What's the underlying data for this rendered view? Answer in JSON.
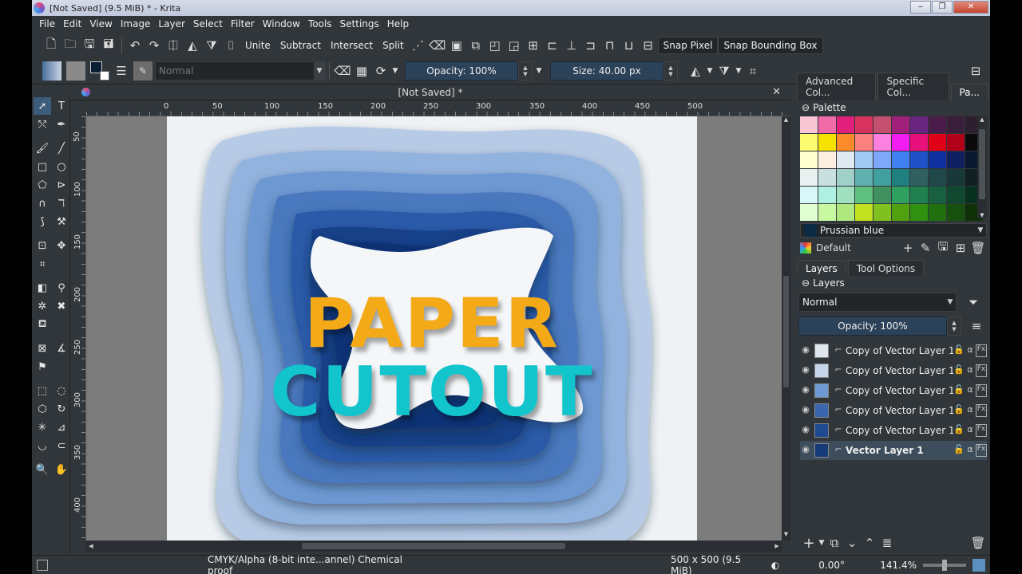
{
  "window": {
    "title": "[Not Saved]  (9.5 MiB)  * - Krita",
    "minimize": "‒",
    "restore": "❐",
    "close": "✕"
  },
  "menu": [
    "File",
    "Edit",
    "View",
    "Image",
    "Layer",
    "Select",
    "Filter",
    "Window",
    "Tools",
    "Settings",
    "Help"
  ],
  "toolbar": {
    "unite": "Unite",
    "subtract": "Subtract",
    "intersect": "Intersect",
    "split": "Split",
    "snap_pixel": "Snap Pixel",
    "snap_bbox": "Snap Bounding Box",
    "blend_mode": "Normal",
    "opacity": "Opacity: 100%",
    "size": "Size: 40.00 px"
  },
  "document": {
    "tab_title": "[Not Saved]   *",
    "ruler_h": [
      "0",
      "50",
      "100",
      "150",
      "200",
      "250",
      "300",
      "350",
      "400",
      "450",
      "500"
    ],
    "ruler_v": [
      "50",
      "100",
      "150",
      "200",
      "250",
      "300",
      "350",
      "400"
    ],
    "artwork_line1": "PAPER",
    "artwork_line2": "CUTOUT"
  },
  "dockers": {
    "tabs": [
      "Advanced Col...",
      "Specific Col...",
      "Pa..."
    ],
    "palette_title": "Palette",
    "palette_colors": [
      "#f9c6d6",
      "#f06ba8",
      "#e0207a",
      "#d8325e",
      "#c45070",
      "#a0207a",
      "#6a2580",
      "#4a1c4a",
      "#3a1f3a",
      "#2e1f2e",
      "#fbfb70",
      "#f6e200",
      "#fb8a2a",
      "#fb8080",
      "#fb80e0",
      "#f01cf0",
      "#e8107a",
      "#e00018",
      "#b0001a",
      "#0a0a0a",
      "#fefed0",
      "#fef0e0",
      "#e0e8f0",
      "#a0c8f0",
      "#80a8f8",
      "#4080f0",
      "#2050c8",
      "#1030a0",
      "#102060",
      "#0a1830",
      "#e8f0f0",
      "#c8e0e0",
      "#a0d0c8",
      "#60b0b0",
      "#40a0a0",
      "#208080",
      "#306060",
      "#204848",
      "#183838",
      "#102020",
      "#d8f8f8",
      "#b0f0e0",
      "#a0e0c0",
      "#60c080",
      "#409060",
      "#30a060",
      "#208050",
      "#186040",
      "#104830",
      "#083020",
      "#e0fed0",
      "#c8f8a0",
      "#b0e880",
      "#c0e020",
      "#80c020",
      "#50a010",
      "#309010",
      "#207010",
      "#185010",
      "#103008"
    ],
    "selected_color": "Prussian blue",
    "palette_name": "Default",
    "layers_tab": "Layers",
    "tool_options_tab": "Tool Options",
    "layers_title": "Layers",
    "layer_blend": "Normal",
    "layer_opacity": "Opacity:  100%",
    "layers": [
      {
        "name": "Copy of Vector Layer 1",
        "thumb": "#dfe6ee"
      },
      {
        "name": "Copy of Vector Layer 1",
        "thumb": "#c6d5ea"
      },
      {
        "name": "Copy of Vector Layer 1",
        "thumb": "#6d9ad2"
      },
      {
        "name": "Copy of Vector Layer 1",
        "thumb": "#3a66b0"
      },
      {
        "name": "Copy of Vector Layer 1",
        "thumb": "#1f4a92"
      },
      {
        "name": "Vector Layer 1",
        "thumb": "#173a78"
      }
    ]
  },
  "status": {
    "color_space": "CMYK/Alpha (8-bit inte...annel)  Chemical proof",
    "dimensions": "500 x 500 (9.5 MiB)",
    "rotation": "0.00°",
    "zoom": "141.4%"
  }
}
